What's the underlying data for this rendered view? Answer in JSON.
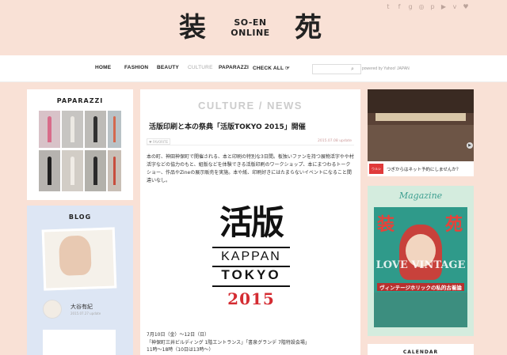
{
  "social_icons": [
    "twitter-icon",
    "facebook-icon",
    "google-plus-icon",
    "instagram-icon",
    "pinterest-icon",
    "youtube-icon",
    "vimeo-icon",
    "heart-icon"
  ],
  "social_glyphs": [
    "t",
    "f",
    "g",
    "◎",
    "p",
    "▶",
    "v",
    "♥"
  ],
  "logo": {
    "kanji_left": "装",
    "kanji_right": "苑",
    "line1": "SO-EN",
    "line2": "ONLINE"
  },
  "nav": {
    "items": [
      "HOME",
      "FASHION",
      "BEAUTY",
      "CULTURE",
      "PAPARAZZI",
      "CHECK ALL ☞"
    ],
    "active": "CULTURE"
  },
  "search": {
    "placeholder": "",
    "powered": "powered by Yahoo! JAPAN"
  },
  "sidebar": {
    "paparazzi_title": "PAPARAZZI",
    "blog_title": "BLOG",
    "blog_author": "大谷有紀",
    "blog_date": "2015.07.27 update"
  },
  "article": {
    "category": "CULTURE / NEWS",
    "title": "活版印刷と本の祭典「活版TOKYO 2015」開催",
    "favorite": "♥ FAVORITE",
    "date": "2015.07.08 update",
    "body": "本の町、神田神保町で開催される、本と印刷の特別な3日間。板独いファンを持つ展物活字やや村活字などの協力のもと、組版などを体験できる活版印刷のワークショップ、本にまつわるトークショー、作品やZineの展示販売を実施。本や紙、印刷好きにはたまらないイベントになること間違いなし。",
    "image": {
      "big": "活版",
      "kappan": "KAPPAN",
      "tokyo": "TOKYO",
      "year": "2015"
    },
    "info": [
      "7月10日（金）〜12日（日）",
      "「神保町三井ビルディング 1階エントランス」「書泉グランデ 7階特設会場」",
      "11時〜18時（10日は13時〜）"
    ]
  },
  "ad": {
    "badge": "ウルシ",
    "text": "つぎからはネット予約にしませんか？"
  },
  "magazine": {
    "title": "Magazine",
    "cover_text": "ヴィンテージホリックの私的古着論",
    "cover_big": "LOVE VINTAGE"
  },
  "calendar": {
    "title": "CALENDAR"
  }
}
